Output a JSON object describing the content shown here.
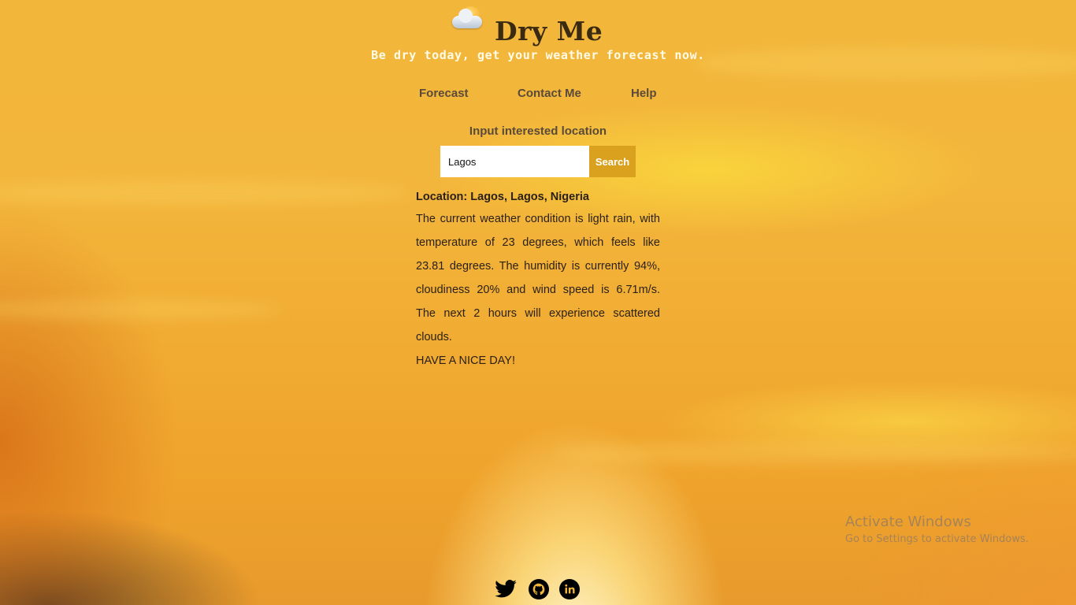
{
  "header": {
    "logo_icon": "sun-cloud-icon",
    "title": "Dry Me",
    "tagline": "Be dry today, get your weather forecast now."
  },
  "nav": {
    "items": [
      {
        "label": "Forecast"
      },
      {
        "label": "Contact Me"
      },
      {
        "label": "Help"
      }
    ]
  },
  "search": {
    "label": "Input interested location",
    "value": "Lagos",
    "button_label": "Search"
  },
  "result": {
    "location": "Location: Lagos, Lagos, Nigeria",
    "description": "The current weather condition is light rain, with temperature of 23 degrees, which feels like 23.81 degrees. The humidity is currently 94%, cloudiness 20% and wind speed is 6.71m/s. The next 2 hours will experience scattered clouds.",
    "closing": "HAVE A NICE DAY!"
  },
  "watermark": {
    "line1": "Activate Windows",
    "line2": "Go to Settings to activate Windows."
  },
  "social": {
    "icons": [
      "twitter-icon",
      "github-icon",
      "linkedin-icon"
    ]
  },
  "colors": {
    "button": "#d9a11d",
    "text": "#2c2118",
    "nav": "#5a4a3a"
  }
}
